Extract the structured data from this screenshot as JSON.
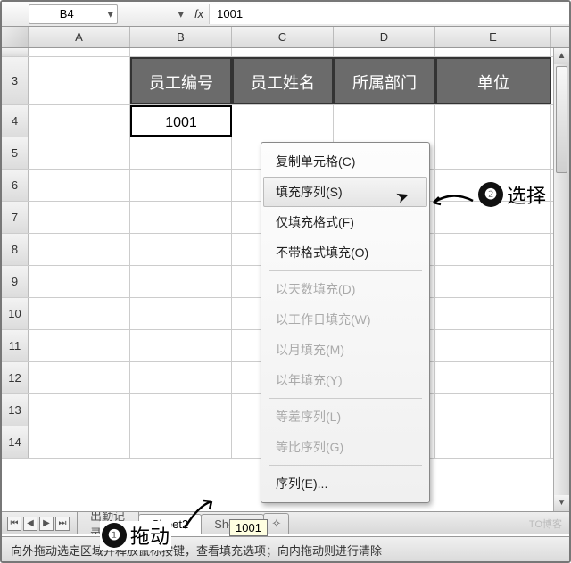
{
  "formula_bar": {
    "cell_ref": "B4",
    "fx": "fx",
    "value": "1001"
  },
  "columns": [
    "A",
    "B",
    "C",
    "D",
    "E"
  ],
  "header_row": {
    "B": "员工编号",
    "C": "员工姓名",
    "D": "所属部门",
    "E": "单位"
  },
  "rows": {
    "r3": "3",
    "r4": "4",
    "r5": "5",
    "r6": "6",
    "r7": "7",
    "r8": "8",
    "r9": "9",
    "r10": "10",
    "r11": "11",
    "r12": "12",
    "r13": "13",
    "r14": "14"
  },
  "cells": {
    "B4": "1001"
  },
  "context_menu": {
    "copy_cells": "复制单元格(C)",
    "fill_series": "填充序列(S)",
    "fill_format_only": "仅填充格式(F)",
    "fill_without_format": "不带格式填充(O)",
    "fill_days": "以天数填充(D)",
    "fill_weekdays": "以工作日填充(W)",
    "fill_months": "以月填充(M)",
    "fill_years": "以年填充(Y)",
    "linear": "等差序列(L)",
    "growth": "等比序列(G)",
    "series": "序列(E)..."
  },
  "callouts": {
    "n1": "❶",
    "t1": "拖动",
    "n2": "❷",
    "t2": "选择"
  },
  "tabs": {
    "hidden": "出勤记录",
    "s2": "Sheet2",
    "s3": "Sheet3"
  },
  "tooltip": "1001",
  "status_text": "向外拖动选定区域并释放鼠标按键，查看填充选项；向内拖动则进行清除",
  "watermark": "TO博客"
}
